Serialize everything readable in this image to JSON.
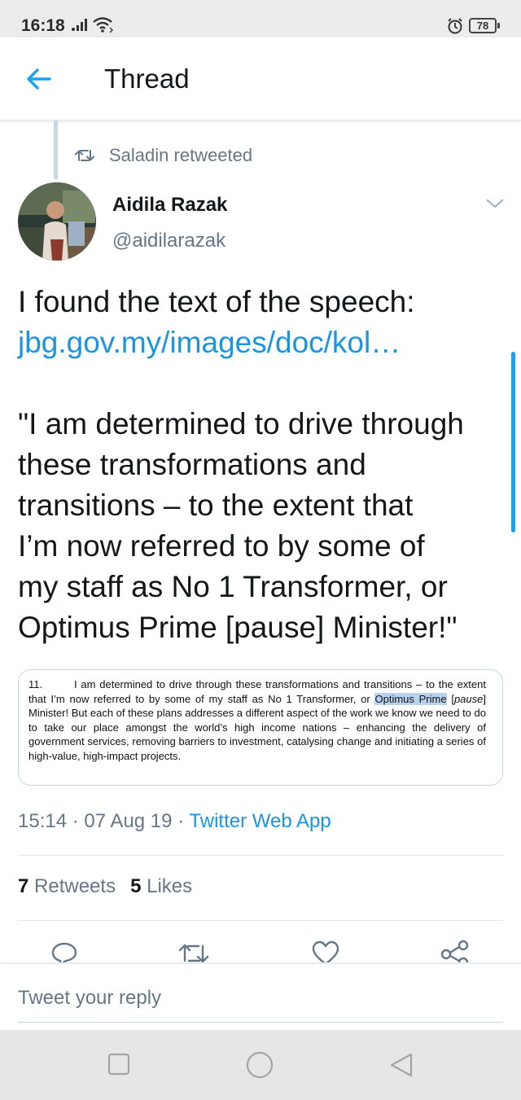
{
  "status_bar": {
    "time": "16:18",
    "battery": "78"
  },
  "header": {
    "title": "Thread"
  },
  "retweet": {
    "text": "Saladin retweeted"
  },
  "tweet": {
    "author_name": "Aidila Razak",
    "author_handle": "@aidilarazak",
    "line1": "I found the text of the speech:",
    "link": "jbg.gov.my/images/doc/kol…",
    "quote_lines": [
      "\"I am determined to drive through",
      "these transformations and",
      "transitions – to the extent that",
      "I’m now referred to by some of",
      "my staff as No 1 Transformer, or",
      "Optimus Prime [pause] Minister!\""
    ],
    "image_doc": {
      "number": "11.",
      "part1": "I am determined to drive through these transformations and transitions – to the extent that I’m now referred to by some of my staff as No 1 Transformer, or ",
      "highlight": "Optimus Prime",
      "part2": " [",
      "italic": "pause",
      "part3": "] Minister! But each of these plans addresses a different aspect of the work we know we need to do to take our place amongst the world’s high income nations – enhancing the delivery of government services, removing barriers to investment, catalysing change and initiating a series of high-value, high-impact projects."
    },
    "time": "15:14",
    "date": "07 Aug 19",
    "separator": " · ",
    "via": "Twitter Web App",
    "retweets_count": "7",
    "retweets_label": "Retweets",
    "likes_count": "5",
    "likes_label": "Likes"
  },
  "reply": {
    "placeholder": "Tweet your reply"
  },
  "colors": {
    "accent": "#1da1f2",
    "link": "#1b95e0",
    "secondary_text": "#657786"
  },
  "icons": [
    "back-arrow-icon",
    "retweet-icon",
    "chevron-down-icon",
    "reply-icon",
    "like-icon",
    "share-icon",
    "recent-apps-icon",
    "home-icon",
    "back-icon"
  ]
}
